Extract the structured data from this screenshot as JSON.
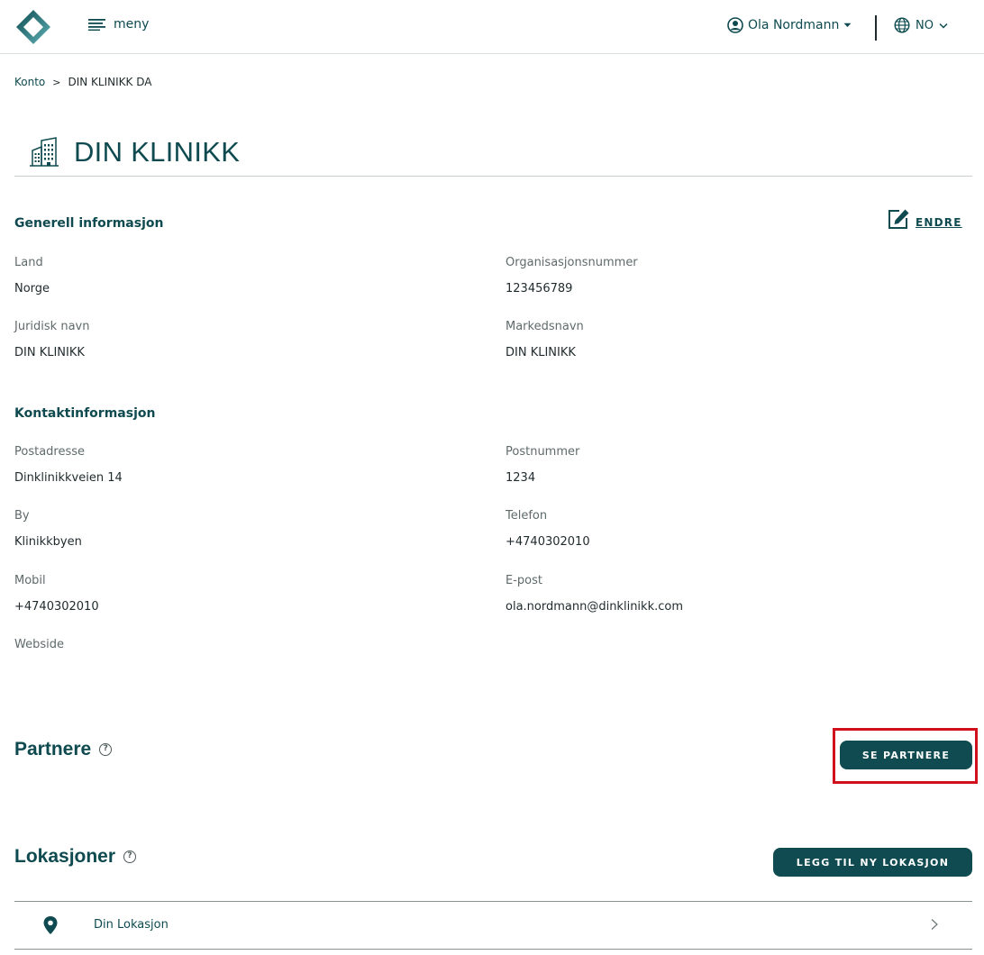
{
  "header": {
    "menu_label": "meny",
    "user_name": "Ola Nordmann",
    "language": "NO"
  },
  "breadcrumb": {
    "root": "Konto",
    "separator": ">",
    "current": "DIN KLINIKK DA"
  },
  "page": {
    "title": "DIN KLINIKK"
  },
  "general": {
    "title": "Generell informasjon",
    "edit_label": "ENDRE",
    "fields": [
      {
        "label": "Land",
        "value": "Norge"
      },
      {
        "label": "Organisasjonsnummer",
        "value": "123456789"
      },
      {
        "label": "Juridisk navn",
        "value": "DIN KLINIKK"
      },
      {
        "label": "Markedsnavn",
        "value": "DIN KLINIKK"
      }
    ]
  },
  "contact": {
    "title": "Kontaktinformasjon",
    "fields": [
      {
        "label": "Postadresse",
        "value": "Dinklinikkveien 14"
      },
      {
        "label": "Postnummer",
        "value": "1234"
      },
      {
        "label": "By",
        "value": "Klinikkbyen"
      },
      {
        "label": "Telefon",
        "value": "+4740302010"
      },
      {
        "label": "Mobil",
        "value": "+4740302010"
      },
      {
        "label": "E-post",
        "value": "ola.nordmann@dinklinikk.com"
      },
      {
        "label": "Webside",
        "value": ""
      }
    ]
  },
  "partners": {
    "title": "Partnere",
    "help": "?",
    "button_label": "SE PARTNERE"
  },
  "locations": {
    "title": "Lokasjoner",
    "help": "?",
    "button_label": "LEGG TIL NY LOKASJON",
    "items": [
      {
        "name": "Din Lokasjon"
      }
    ]
  },
  "colors": {
    "primary": "#0f4b50",
    "highlight": "#d0101c"
  },
  "icons": {
    "logo": "diamond-logo-icon",
    "menu": "hamburger-icon",
    "user": "user-circle-icon",
    "language": "globe-icon",
    "building": "building-icon",
    "edit": "edit-icon",
    "location": "map-pin-icon",
    "row_chevron": "chevron-right-icon"
  }
}
